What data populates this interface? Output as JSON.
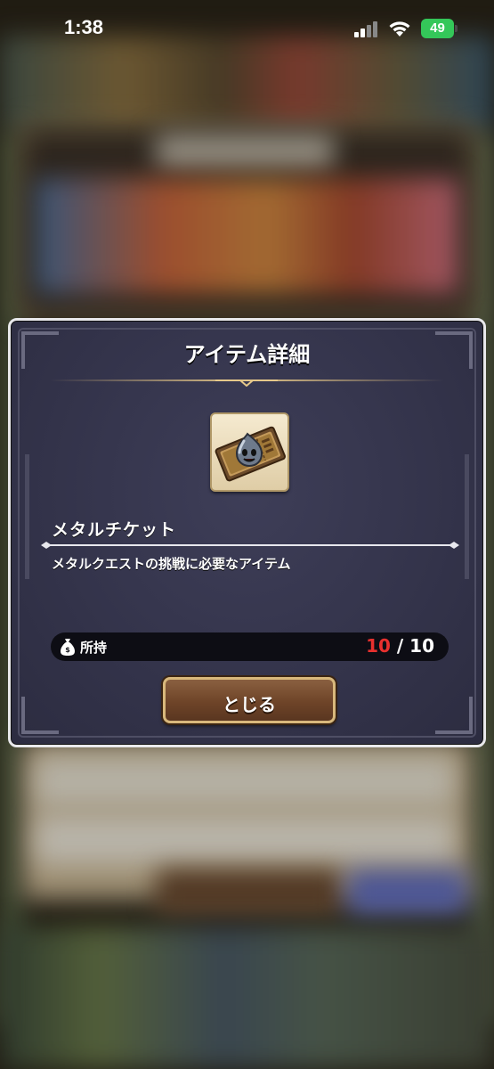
{
  "status_bar": {
    "time": "1:38",
    "battery": "49"
  },
  "dialog": {
    "title": "アイテム詳細",
    "item": {
      "icon": "metal-ticket-icon",
      "name": "メタルチケット",
      "description": "メタルクエストの挑戦に必要なアイテム"
    },
    "owned": {
      "label": "所持",
      "current": "10",
      "separator": "/",
      "max": "10"
    },
    "close_label": "とじる"
  },
  "colors": {
    "dialog_bg": "#33334a",
    "border": "#e9e9ec",
    "gold": "#d8b87c",
    "count_red": "#e8302e",
    "button_brown": "#6e4428",
    "battery_green": "#34c759"
  }
}
